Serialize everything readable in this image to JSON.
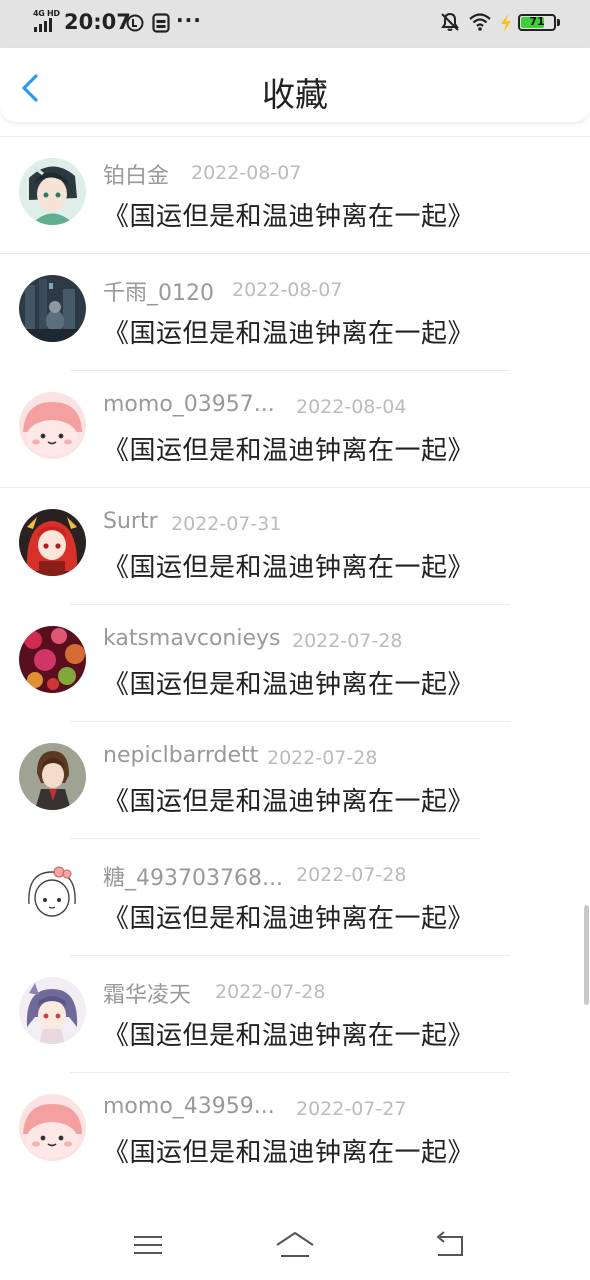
{
  "status_bar": {
    "network": "4G HD",
    "time": "20:07",
    "battery": "71",
    "battery_level": 0.71,
    "icons": [
      "signal-icon",
      "data-saver-icon",
      "sim-icon",
      "more-icon",
      "mute-icon",
      "wifi-icon",
      "charging-icon",
      "battery-icon"
    ]
  },
  "header": {
    "title": "收藏",
    "back_icon": "chevron-left-icon"
  },
  "colors": {
    "accent": "#2a9cf0",
    "username": "#999999",
    "date": "#bbbbbb",
    "text": "#222222",
    "battery": "#3fcf3a"
  },
  "favorites": [
    {
      "username": "铂白金",
      "date": "2022-08-07",
      "title": "《国运但是和温迪钟离在一起》",
      "avatar": "anime-boy-avatar"
    },
    {
      "username": "千雨_0120",
      "date": "2022-08-07",
      "title": "《国运但是和温迪钟离在一起》",
      "avatar": "dark-city-avatar"
    },
    {
      "username": "momo_03957...",
      "date": "2022-08-04",
      "title": "《国运但是和温迪钟离在一起》",
      "avatar": "pink-blob-avatar"
    },
    {
      "username": "Surtr",
      "date": "2022-07-31",
      "title": "《国运但是和温迪钟离在一起》",
      "avatar": "red-hair-avatar"
    },
    {
      "username": "katsmavconieys",
      "date": "2022-07-28",
      "title": "《国运但是和温迪钟离在一起》",
      "avatar": "bokeh-lights-avatar"
    },
    {
      "username": "nepiclbarrdett",
      "date": "2022-07-28",
      "title": "《国运但是和温迪钟离在一起》",
      "avatar": "brown-hair-avatar"
    },
    {
      "username": "糖_493703768...",
      "date": "2022-07-28",
      "title": "《国运但是和温迪钟离在一起》",
      "avatar": "sketch-girl-avatar"
    },
    {
      "username": "霜华凌天",
      "date": "2022-07-28",
      "title": "《国运但是和温迪钟离在一起》",
      "avatar": "purple-hair-avatar"
    },
    {
      "username": "momo_43959...",
      "date": "2022-07-27",
      "title": "《国运但是和温迪钟离在一起》",
      "avatar": "pink-blob-avatar"
    }
  ],
  "nav_bar": {
    "icons": [
      "menu-icon",
      "home-icon",
      "back-icon"
    ]
  }
}
